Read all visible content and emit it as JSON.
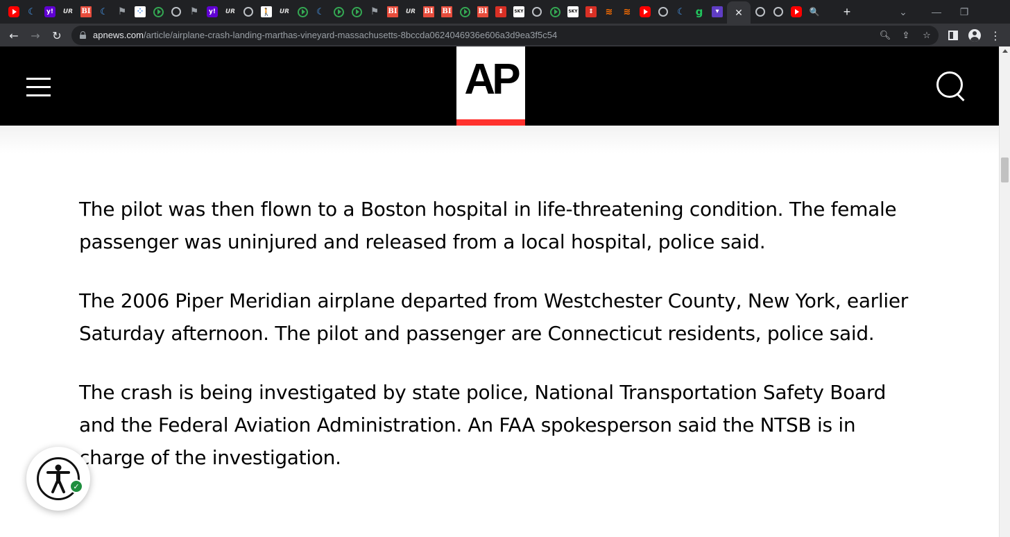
{
  "browser": {
    "tabs": [
      {
        "icon": "youtube-icon",
        "glyph": ""
      },
      {
        "icon": "moon-icon",
        "glyph": "☾"
      },
      {
        "icon": "yahoo-icon",
        "glyph": "y!"
      },
      {
        "icon": "ultra-icon",
        "glyph": "UR"
      },
      {
        "icon": "business-insider-icon",
        "glyph": "BI"
      },
      {
        "icon": "moon-icon",
        "glyph": "☾"
      },
      {
        "icon": "flag-icon",
        "glyph": "⚑"
      },
      {
        "icon": "dots-icon",
        "glyph": "⁘"
      },
      {
        "icon": "play-icon",
        "glyph": ""
      },
      {
        "icon": "globe-icon",
        "glyph": ""
      },
      {
        "icon": "flag-icon",
        "glyph": "⚑"
      },
      {
        "icon": "yahoo-icon",
        "glyph": "y!"
      },
      {
        "icon": "ultra-icon",
        "glyph": "UR"
      },
      {
        "icon": "globe-icon",
        "glyph": ""
      },
      {
        "icon": "walk-icon",
        "glyph": "🚶"
      },
      {
        "icon": "ultra-icon",
        "glyph": "UR"
      },
      {
        "icon": "play-icon",
        "glyph": ""
      },
      {
        "icon": "moon-icon",
        "glyph": "☾"
      },
      {
        "icon": "play-icon",
        "glyph": ""
      },
      {
        "icon": "play-icon",
        "glyph": ""
      },
      {
        "icon": "flag-icon",
        "glyph": "⚑"
      },
      {
        "icon": "business-insider-icon",
        "glyph": "BI"
      },
      {
        "icon": "ultra-icon",
        "glyph": "UR"
      },
      {
        "icon": "business-insider-icon",
        "glyph": "BI"
      },
      {
        "icon": "business-insider-icon",
        "glyph": "BI"
      },
      {
        "icon": "play-icon",
        "glyph": ""
      },
      {
        "icon": "business-insider-icon",
        "glyph": "BI"
      },
      {
        "icon": "red-arrow-icon",
        "glyph": "⇕"
      },
      {
        "icon": "news-icon",
        "glyph": "SKY"
      },
      {
        "icon": "globe-icon",
        "glyph": ""
      },
      {
        "icon": "play-icon",
        "glyph": ""
      },
      {
        "icon": "news-icon",
        "glyph": "SKY"
      },
      {
        "icon": "red-arrow-icon",
        "glyph": "⇕"
      },
      {
        "icon": "stack-icon",
        "glyph": "≋"
      },
      {
        "icon": "stack-icon",
        "glyph": "≋"
      },
      {
        "icon": "youtube-icon",
        "glyph": ""
      },
      {
        "icon": "globe-icon",
        "glyph": ""
      },
      {
        "icon": "moon-icon",
        "glyph": "☾"
      },
      {
        "icon": "g-icon",
        "glyph": "g"
      },
      {
        "icon": "purple-icon",
        "glyph": "▾"
      },
      {
        "icon": "tab-close-icon",
        "glyph": "✕",
        "active": true
      },
      {
        "icon": "globe-icon",
        "glyph": ""
      },
      {
        "icon": "globe-icon",
        "glyph": ""
      },
      {
        "icon": "youtube-icon",
        "glyph": ""
      },
      {
        "icon": "search-icon",
        "glyph": "🔍"
      }
    ],
    "new_tab": "+",
    "window_controls": {
      "dropdown": "⌄",
      "minimize": "—",
      "restore": "❐"
    },
    "url_host": "apnews.com",
    "url_path": "/article/airplane-crash-landing-marthas-vineyard-massachusetts-8bccda0624046936e606a3d9ea3f5c54"
  },
  "site": {
    "logo": "AP",
    "colors": {
      "header_bg": "#000000",
      "logo_bar": "#ff322e"
    }
  },
  "article": {
    "paragraphs": [
      "The pilot was then flown to a Boston hospital in life-threatening condition. The female passenger was uninjured and released from a local hospital, police said.",
      "The 2006 Piper Meridian airplane departed from Westchester County, New York, earlier Saturday afternoon. The pilot and passenger are Connecticut residents, police said.",
      "The crash is being investigated by state police, National Transportation Safety Board and the Federal Aviation Administration. An FAA spokesperson said the NTSB is in charge of the investigation."
    ]
  }
}
